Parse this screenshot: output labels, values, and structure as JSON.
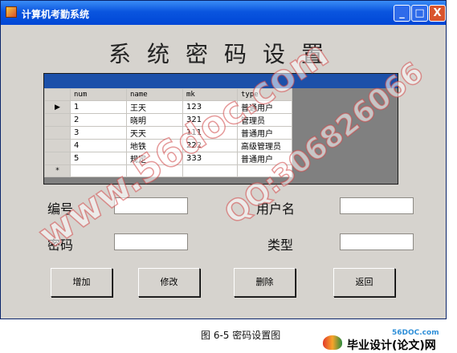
{
  "window": {
    "title": "计算机考勤系统",
    "minimize": "_",
    "maximize": "□",
    "close": "X"
  },
  "heading": "系统密码设置",
  "grid": {
    "columns": [
      "num",
      "name",
      "mk",
      "type"
    ],
    "rows": [
      {
        "selector": "▶",
        "num": "1",
        "name": "王天",
        "mk": "123",
        "type": "普通用户"
      },
      {
        "selector": "",
        "num": "2",
        "name": "晓明",
        "mk": "321",
        "type": "管理员"
      },
      {
        "selector": "",
        "num": "3",
        "name": "天天",
        "mk": "111",
        "type": "普通用户"
      },
      {
        "selector": "",
        "num": "4",
        "name": "地铁",
        "mk": "222",
        "type": "高级管理员"
      },
      {
        "selector": "",
        "num": "5",
        "name": "规定",
        "mk": "333",
        "type": "普通用户"
      }
    ],
    "new_row_marker": "*"
  },
  "form": {
    "number_label": "编号",
    "username_label": "用户名",
    "password_label": "密码",
    "type_label": "类型",
    "number_value": "",
    "username_value": "",
    "password_value": "",
    "type_value": ""
  },
  "buttons": {
    "add": "增加",
    "edit": "修改",
    "delete": "删除",
    "back": "返回"
  },
  "watermarks": {
    "site": "www.56doc.com",
    "qq": "QQ:306826066"
  },
  "caption": "图 6-5 密码设置图",
  "footer_logo": {
    "url": "56DOC.com",
    "text": "毕业设计(论文)网"
  }
}
